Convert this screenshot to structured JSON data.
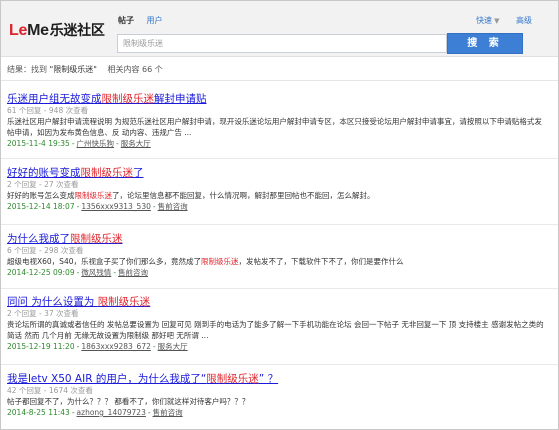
{
  "header": {
    "logo_le": "Le",
    "logo_me": "Me",
    "logo_cn": "乐迷社区",
    "tab_posts": "帖子",
    "tab_users": "用户",
    "link_quick": "快速",
    "link_advanced": "高级",
    "search_placeholder": "限制级乐迷",
    "search_button": "搜 索"
  },
  "summary": {
    "prefix": "结果：找到",
    "keyword": "\"限制级乐迷\"",
    "related": "相关内容 66 个"
  },
  "results": [
    {
      "title_pre": "乐迷用户组无故变成",
      "title_hl": "限制级乐迷",
      "title_post": "解封申请贴",
      "stats": "61 个回复 - 948 次查看",
      "snippet_pre": "乐迷社区用户解封申请流程说明 为规范乐迷社区用户解封申请，现开设乐迷论坛用户解封申请专区，本区只接受论坛用户解封申请事宜，请按照以下申请贴格式发帖申请，如因为发布黄色信息、反 动内容、违规广告 ...",
      "snippet_hl": "",
      "snippet_post": "",
      "date": "2015-11-4 19:35",
      "user": "广州快乐狗",
      "forum": "服务大厅"
    },
    {
      "title_pre": "好好的账号变成",
      "title_hl": "限制级乐迷",
      "title_post": "了",
      "stats": "2 个回复 - 27 次查看",
      "snippet_pre": "好好的账号怎么变成",
      "snippet_hl": "限制级乐迷",
      "snippet_post": "了，论坛里信息都不能回复，什么情况啊，解封那里回帖也不能回，怎么解封。",
      "date": "2015-12-14 18:07",
      "user": "1356xxx9313_530",
      "forum": "售前咨询"
    },
    {
      "title_pre": "为什么我成了",
      "title_hl": "限制级乐迷",
      "title_post": "",
      "stats": "6 个回复 - 298 次查看",
      "snippet_pre": "超级电视X60，S40，乐视盒子买了你们那么多，竟然成了",
      "snippet_hl": "限制级乐迷",
      "snippet_post": "，发帖发不了，下载软件下不了，你们是要作什么",
      "date": "2014-12-25 09:09",
      "user": "微风残情",
      "forum": "售前咨询"
    },
    {
      "title_pre": "同问 为什么设置为 ",
      "title_hl": "限制级乐迷",
      "title_post": "",
      "stats": "2 个回复 - 37 次查看",
      "snippet_pre": "贵论坛所谓的真诚或者信任的 发帖总要设置为 回复可见 刚到手的电话为了能多了解一下手机功能在论坛 会回一下帖子 无非回复一下 顶 支持楼主 感谢发帖之类的简话 然而 几个月前 无缘无故设置为限制级 那好吧 无所谓 ...",
      "snippet_hl": "",
      "snippet_post": "",
      "date": "2015-12-19 11:20",
      "user": "1863xxx9283_672",
      "forum": "服务大厅"
    },
    {
      "title_pre": "我是letv X50 AIR 的用户，为什么我成了“",
      "title_hl": "限制级乐迷",
      "title_post": "” ？",
      "stats": "42 个回复 - 1674 次查看",
      "snippet_pre": "帖子都回复不了，为什么？？？ 都看不了，你们就这样对待客户吗？？？",
      "snippet_hl": "",
      "snippet_post": "",
      "date": "2014-8-25 11:43",
      "user": "azhong_14079723",
      "forum": "售前咨询"
    }
  ]
}
